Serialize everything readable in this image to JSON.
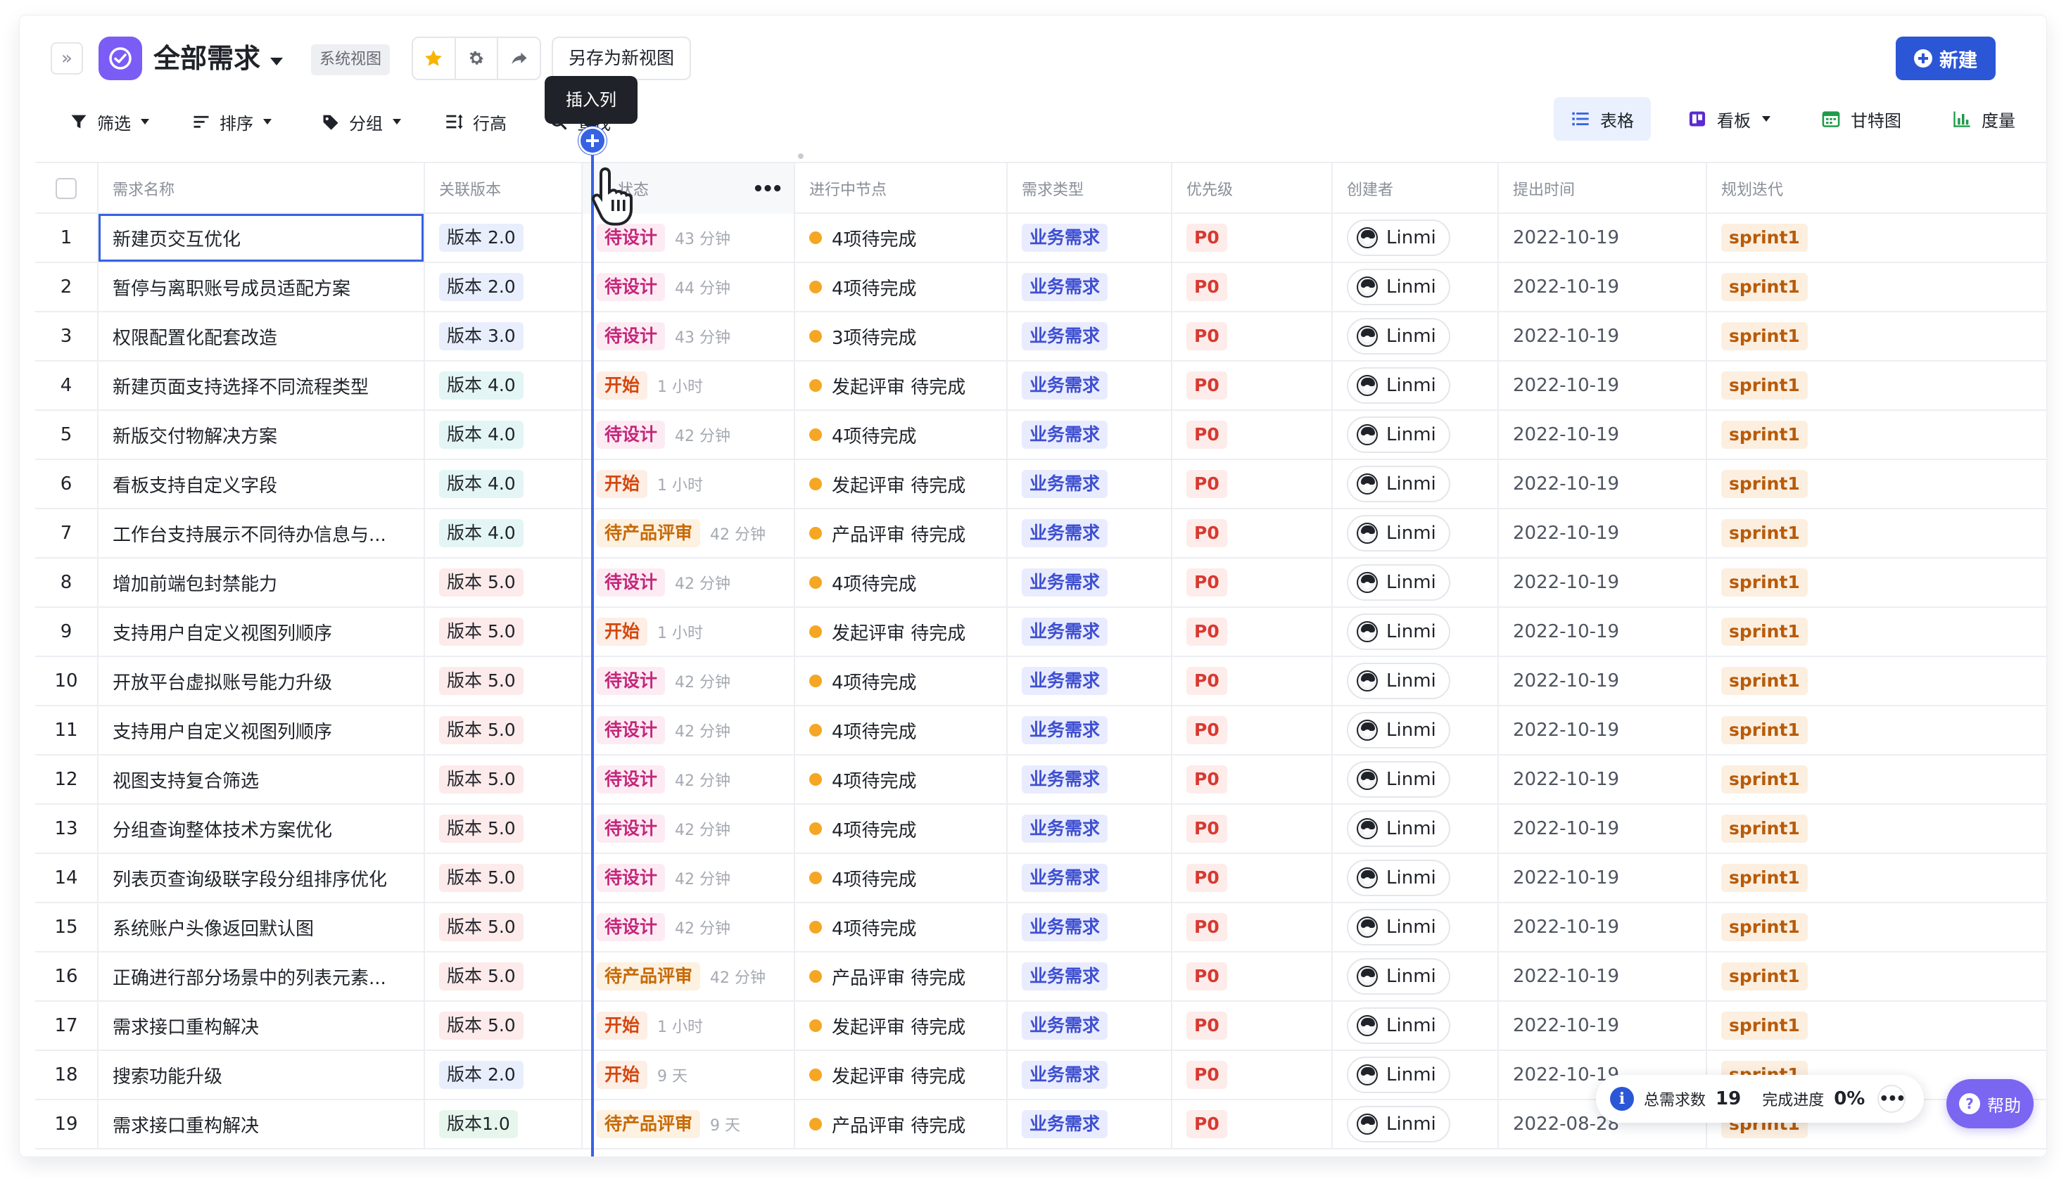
{
  "header": {
    "expand_glyph": "»",
    "view_title": "全部需求",
    "system_tag": "系统视图",
    "save_as_view": "另存为新视图",
    "new_button": "新建"
  },
  "toolbar": {
    "filter": "筛选",
    "sort": "排序",
    "group": "分组",
    "row_height": "行高",
    "find": "查找",
    "views": {
      "table": "表格",
      "board": "看板",
      "gantt": "甘特图",
      "metrics": "度量"
    },
    "insert_column_tooltip": "插入列"
  },
  "columns": [
    "需求名称",
    "关联版本",
    "状态",
    "进行中节点",
    "需求类型",
    "优先级",
    "创建者",
    "提出时间",
    "规划迭代"
  ],
  "rows": [
    {
      "no": "1",
      "name": "新建页交互优化",
      "version": "版本 2.0",
      "vclass": "v2",
      "status": "待设计",
      "sclass": "",
      "dur": "43 分钟",
      "node": "4项待完成",
      "type": "业务需求",
      "priority": "P0",
      "creator": "Linmi",
      "date": "2022-10-19",
      "sprint": "sprint1"
    },
    {
      "no": "2",
      "name": "暂停与离职账号成员适配方案",
      "version": "版本 2.0",
      "vclass": "v2",
      "status": "待设计",
      "sclass": "",
      "dur": "44 分钟",
      "node": "4项待完成",
      "type": "业务需求",
      "priority": "P0",
      "creator": "Linmi",
      "date": "2022-10-19",
      "sprint": "sprint1"
    },
    {
      "no": "3",
      "name": "权限配置化配套改造",
      "version": "版本 3.0",
      "vclass": "v3",
      "status": "待设计",
      "sclass": "",
      "dur": "43 分钟",
      "node": "3项待完成",
      "type": "业务需求",
      "priority": "P0",
      "creator": "Linmi",
      "date": "2022-10-19",
      "sprint": "sprint1"
    },
    {
      "no": "4",
      "name": "新建页面支持选择不同流程类型",
      "version": "版本 4.0",
      "vclass": "v4",
      "status": "开始",
      "sclass": "start",
      "dur": "1 小时",
      "node": "发起评审 待完成",
      "type": "业务需求",
      "priority": "P0",
      "creator": "Linmi",
      "date": "2022-10-19",
      "sprint": "sprint1"
    },
    {
      "no": "5",
      "name": "新版交付物解决方案",
      "version": "版本 4.0",
      "vclass": "v4",
      "status": "待设计",
      "sclass": "",
      "dur": "42 分钟",
      "node": "4项待完成",
      "type": "业务需求",
      "priority": "P0",
      "creator": "Linmi",
      "date": "2022-10-19",
      "sprint": "sprint1"
    },
    {
      "no": "6",
      "name": "看板支持自定义字段",
      "version": "版本 4.0",
      "vclass": "v4",
      "status": "开始",
      "sclass": "start",
      "dur": "1 小时",
      "node": "发起评审 待完成",
      "type": "业务需求",
      "priority": "P0",
      "creator": "Linmi",
      "date": "2022-10-19",
      "sprint": "sprint1"
    },
    {
      "no": "7",
      "name": "工作台支持展示不同待办信息与...",
      "version": "版本 4.0",
      "vclass": "v4",
      "status": "待产品评审",
      "sclass": "review",
      "dur": "42 分钟",
      "node": "产品评审 待完成",
      "type": "业务需求",
      "priority": "P0",
      "creator": "Linmi",
      "date": "2022-10-19",
      "sprint": "sprint1"
    },
    {
      "no": "8",
      "name": "增加前端包封禁能力",
      "version": "版本 5.0",
      "vclass": "v5",
      "status": "待设计",
      "sclass": "",
      "dur": "42 分钟",
      "node": "4项待完成",
      "type": "业务需求",
      "priority": "P0",
      "creator": "Linmi",
      "date": "2022-10-19",
      "sprint": "sprint1"
    },
    {
      "no": "9",
      "name": "支持用户自定义视图列顺序",
      "version": "版本 5.0",
      "vclass": "v5",
      "status": "开始",
      "sclass": "start",
      "dur": "1 小时",
      "node": "发起评审 待完成",
      "type": "业务需求",
      "priority": "P0",
      "creator": "Linmi",
      "date": "2022-10-19",
      "sprint": "sprint1"
    },
    {
      "no": "10",
      "name": "开放平台虚拟账号能力升级",
      "version": "版本 5.0",
      "vclass": "v5",
      "status": "待设计",
      "sclass": "",
      "dur": "42 分钟",
      "node": "4项待完成",
      "type": "业务需求",
      "priority": "P0",
      "creator": "Linmi",
      "date": "2022-10-19",
      "sprint": "sprint1"
    },
    {
      "no": "11",
      "name": "支持用户自定义视图列顺序",
      "version": "版本 5.0",
      "vclass": "v5",
      "status": "待设计",
      "sclass": "",
      "dur": "42 分钟",
      "node": "4项待完成",
      "type": "业务需求",
      "priority": "P0",
      "creator": "Linmi",
      "date": "2022-10-19",
      "sprint": "sprint1"
    },
    {
      "no": "12",
      "name": "视图支持复合筛选",
      "version": "版本 5.0",
      "vclass": "v5",
      "status": "待设计",
      "sclass": "",
      "dur": "42 分钟",
      "node": "4项待完成",
      "type": "业务需求",
      "priority": "P0",
      "creator": "Linmi",
      "date": "2022-10-19",
      "sprint": "sprint1"
    },
    {
      "no": "13",
      "name": "分组查询整体技术方案优化",
      "version": "版本 5.0",
      "vclass": "v5",
      "status": "待设计",
      "sclass": "",
      "dur": "42 分钟",
      "node": "4项待完成",
      "type": "业务需求",
      "priority": "P0",
      "creator": "Linmi",
      "date": "2022-10-19",
      "sprint": "sprint1"
    },
    {
      "no": "14",
      "name": "列表页查询级联字段分组排序优化",
      "version": "版本 5.0",
      "vclass": "v5",
      "status": "待设计",
      "sclass": "",
      "dur": "42 分钟",
      "node": "4项待完成",
      "type": "业务需求",
      "priority": "P0",
      "creator": "Linmi",
      "date": "2022-10-19",
      "sprint": "sprint1"
    },
    {
      "no": "15",
      "name": "系统账户头像返回默认图",
      "version": "版本 5.0",
      "vclass": "v5",
      "status": "待设计",
      "sclass": "",
      "dur": "42 分钟",
      "node": "4项待完成",
      "type": "业务需求",
      "priority": "P0",
      "creator": "Linmi",
      "date": "2022-10-19",
      "sprint": "sprint1"
    },
    {
      "no": "16",
      "name": "正确进行部分场景中的列表元素...",
      "version": "版本 5.0",
      "vclass": "v5",
      "status": "待产品评审",
      "sclass": "review",
      "dur": "42 分钟",
      "node": "产品评审 待完成",
      "type": "业务需求",
      "priority": "P0",
      "creator": "Linmi",
      "date": "2022-10-19",
      "sprint": "sprint1"
    },
    {
      "no": "17",
      "name": "需求接口重构解决",
      "version": "版本 5.0",
      "vclass": "v5",
      "status": "开始",
      "sclass": "start",
      "dur": "1 小时",
      "node": "发起评审 待完成",
      "type": "业务需求",
      "priority": "P0",
      "creator": "Linmi",
      "date": "2022-10-19",
      "sprint": "sprint1"
    },
    {
      "no": "18",
      "name": "搜索功能升级",
      "version": "版本 2.0",
      "vclass": "v2",
      "status": "开始",
      "sclass": "start",
      "dur": "9 天",
      "node": "发起评审 待完成",
      "type": "业务需求",
      "priority": "P0",
      "creator": "Linmi",
      "date": "2022-10-19",
      "sprint": "sprint1"
    },
    {
      "no": "19",
      "name": "需求接口重构解决",
      "version": "版本1.0",
      "vclass": "v1",
      "status": "待产品评审",
      "sclass": "review",
      "dur": "9 天",
      "node": "产品评审 待完成",
      "type": "业务需求",
      "priority": "P0",
      "creator": "Linmi",
      "date": "2022-08-28",
      "sprint": "sprint1"
    }
  ],
  "summary": {
    "total_label": "总需求数",
    "total_value": "19",
    "progress_label": "完成进度",
    "progress_value": "0%",
    "more": "•••"
  },
  "help": {
    "label": "帮助",
    "glyph": "?"
  },
  "colors": {
    "accent": "#3662e3",
    "brand_purple": "#7b5cf5",
    "new_button": "#2b56d6"
  }
}
